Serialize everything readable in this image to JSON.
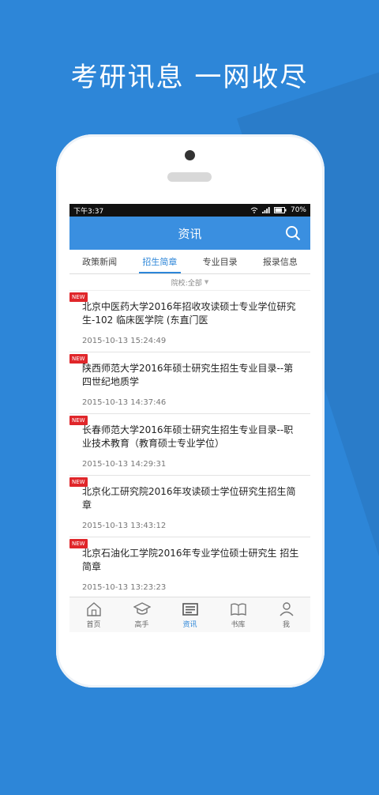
{
  "promo": {
    "headline": "考研讯息 一网收尽"
  },
  "status": {
    "time": "下午3:37",
    "battery": "70%"
  },
  "appbar": {
    "title": "资讯"
  },
  "tabs": [
    {
      "label": "政策新闻",
      "active": false
    },
    {
      "label": "招生简章",
      "active": true
    },
    {
      "label": "专业目录",
      "active": false
    },
    {
      "label": "报录信息",
      "active": false
    }
  ],
  "filter": {
    "label": "院校:全部"
  },
  "badge_text": "NEW",
  "items": [
    {
      "title": "北京中医药大学2016年招收攻读硕士专业学位研究生-102 临床医学院 (东直门医",
      "time": "2015-10-13 15:24:49"
    },
    {
      "title": "陕西师范大学2016年硕士研究生招生专业目录--第四世纪地质学",
      "time": "2015-10-13 14:37:46"
    },
    {
      "title": "长春师范大学2016年硕士研究生招生专业目录--职业技术教育（教育硕士专业学位）",
      "time": "2015-10-13 14:29:31"
    },
    {
      "title": "北京化工研究院2016年攻读硕士学位研究生招生简章",
      "time": "2015-10-13 13:43:12"
    },
    {
      "title": "北京石油化工学院2016年专业学位硕士研究生 招生简章",
      "time": "2015-10-13 13:23:23"
    }
  ],
  "nav": [
    {
      "label": "首页",
      "icon": "home-icon"
    },
    {
      "label": "高手",
      "icon": "grad-cap-icon"
    },
    {
      "label": "资讯",
      "icon": "news-icon",
      "active": true
    },
    {
      "label": "书库",
      "icon": "book-icon"
    },
    {
      "label": "我",
      "icon": "user-icon"
    }
  ],
  "colors": {
    "primary": "#2d86d8",
    "badge": "#e0262a"
  }
}
